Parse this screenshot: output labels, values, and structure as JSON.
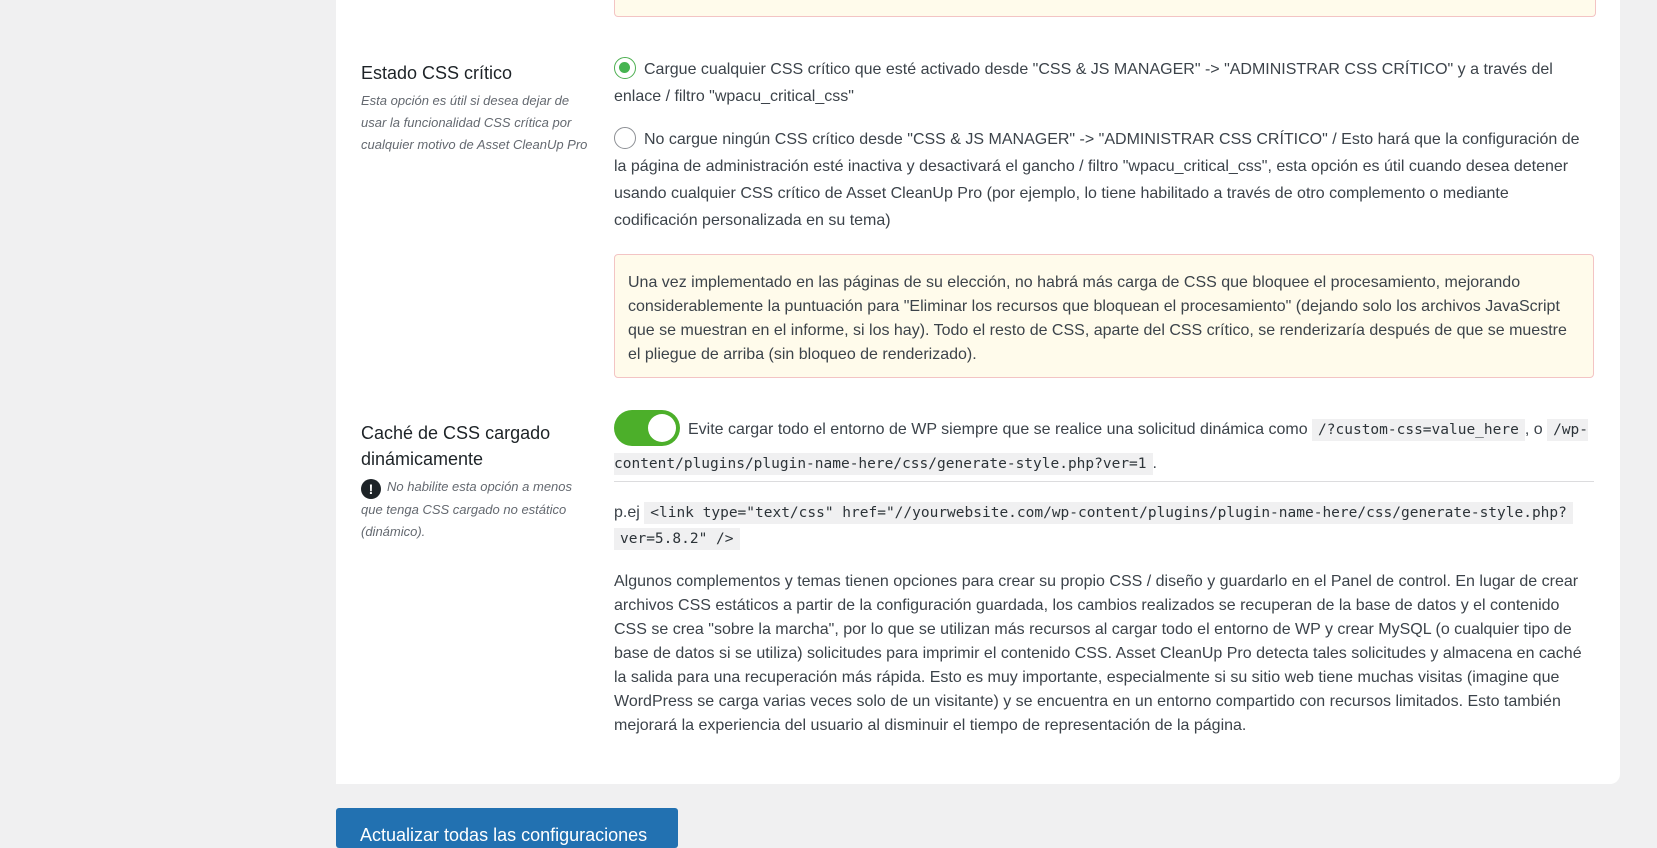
{
  "critical_css": {
    "title": "Estado CSS crítico",
    "description": "Esta opción es útil si desea dejar de usar la funcionalidad CSS crítica por cualquier motivo de Asset CleanUp Pro",
    "option_load": "Cargue cualquier CSS crítico que esté activado desde \"CSS & JS MANAGER\" -> \"ADMINISTRAR CSS CRÍTICO\" y a través del enlace / filtro \"wpacu_critical_css\"",
    "option_no_load": "No cargue ningún CSS crítico desde \"CSS & JS MANAGER\" -> \"ADMINISTRAR CSS CRÍTICO\" / Esto hará que la configuración de la página de administración esté inactiva y desactivará el gancho / filtro \"wpacu_critical_css\", esta opción es útil cuando desea detener usando cualquier CSS crítico de Asset CleanUp Pro (por ejemplo, lo tiene habilitado a través de otro complemento o mediante codificación personalizada en su tema)",
    "notice": "Una vez implementado en las páginas de su elección, no habrá más carga de CSS que bloquee el procesamiento, mejorando considerablemente la puntuación para \"Eliminar los recursos que bloquean el procesamiento\" (dejando solo los archivos JavaScript que se muestran en el informe, si los hay). Todo el resto de CSS, aparte del CSS crítico, se renderizaría después de que se muestre el pliegue de arriba (sin bloqueo de renderizado).",
    "selected": "load"
  },
  "dynamic_css": {
    "title": "Caché de CSS cargado dinámicamente",
    "warning": "No habilite esta opción a menos que tenga CSS cargado no estático (dinámico).",
    "toggle_on": true,
    "toggle_text": "Evite cargar todo el entorno de WP siempre que se realice una solicitud dinámica como",
    "code_1": "/?custom-css=value_here",
    "sep": ", o",
    "code_2": "/wp-content/plugins/plugin-name-here/css/generate-style.php?ver=1",
    "end": ".",
    "example_prefix": "p.ej",
    "example_code_1": "<link type=\"text/css\" href=\"//yourwebsite.com/wp-content/plugins/plugin-name-here/css/generate-style.php?",
    "example_code_2": "ver=5.8.2\" />",
    "paragraph": "Algunos complementos y temas tienen opciones para crear su propio CSS / diseño y guardarlo en el Panel de control. En lugar de crear archivos CSS estáticos a partir de la configuración guardada, los cambios realizados se recuperan de la base de datos y el contenido CSS se crea \"sobre la marcha\", por lo que se utilizan más recursos al cargar todo el entorno de WP y crear MySQL (o cualquier tipo de base de datos si se utiliza) solicitudes para imprimir el contenido CSS. Asset CleanUp Pro detecta tales solicitudes y almacena en caché la salida para una recuperación más rápida. Esto es muy importante, especialmente si su sitio web tiene muchas visitas (imagine que WordPress se carga varias veces solo de un visitante) y se encuentra en un entorno compartido con recursos limitados. Esto también mejorará la experiencia del usuario al disminuir el tiempo de representación de la página."
  },
  "submit_label": "Actualizar todas las configuraciones",
  "colors": {
    "accent": "#2271b1",
    "toggle": "#4caf2a",
    "notice_bg": "#fffbeb"
  }
}
